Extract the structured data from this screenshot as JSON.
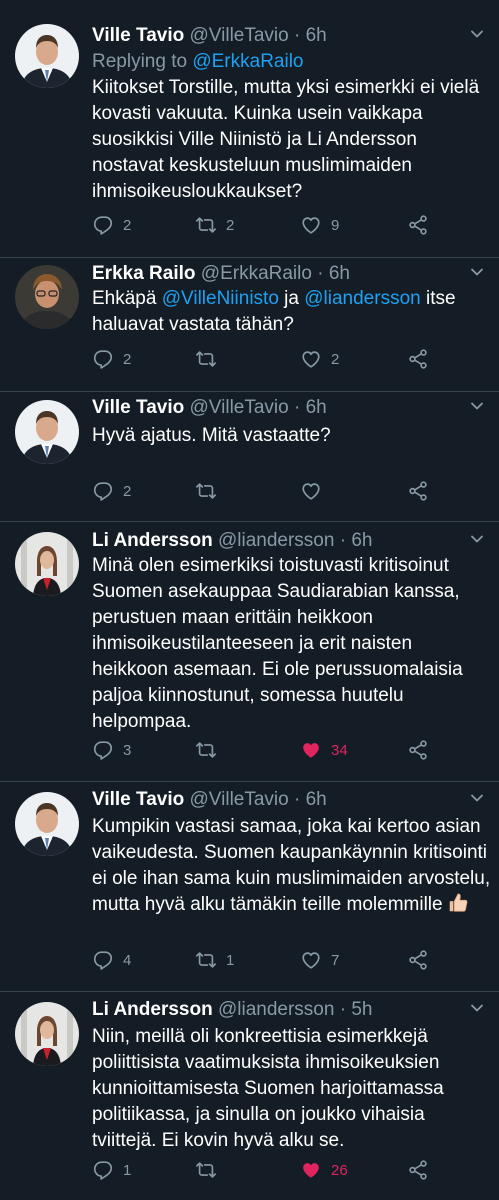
{
  "tweets": [
    {
      "name": "Ville Tavio",
      "handle": "@VilleTavio · 6h",
      "reply_prefix": "Replying to ",
      "reply_to": "@ErkkaRailo",
      "text": "Kiitokset Torstille, mutta yksi esimerkki ei vielä kovasti vakuuta. Kuinka usein vaikkapa suosikkisi Ville Niinistö ja Li Andersson nostavat keskusteluun muslimimaiden ihmisoikeusloukkaukset?",
      "replies": "2",
      "retweets": "2",
      "likes": "9"
    },
    {
      "name": "Erkka Railo",
      "handle": "@ErkkaRailo · 6h",
      "text_a": "Ehkäpä ",
      "mention_a": "@VilleNiinisto",
      "text_b": " ja ",
      "mention_b": "@liandersson",
      "text_c": " itse haluavat vastata tähän?",
      "replies": "2",
      "retweets": "",
      "likes": "2"
    },
    {
      "name": "Ville Tavio",
      "handle": "@VilleTavio · 6h",
      "text": "Hyvä ajatus. Mitä vastaatte?",
      "replies": "2",
      "retweets": "",
      "likes": ""
    },
    {
      "name": "Li Andersson",
      "handle": "@liandersson · 6h",
      "text": "Minä olen esimerkiksi toistuvasti kritisoinut Suomen asekauppaa Saudiarabian kanssa, perustuen maan erittäin heikkoon ihmisoikeustilanteeseen ja erit naisten heikkoon asemaan. Ei ole perussuomalaisia paljoa kiinnostunut, somessa huutelu helpompaa.",
      "replies": "3",
      "retweets": "",
      "likes": "34"
    },
    {
      "name": "Ville Tavio",
      "handle": "@VilleTavio · 6h",
      "text": "Kumpikin vastasi samaa, joka kai kertoo asian vaikeudesta. Suomen kaupankäynnin kritisointi ei ole ihan sama kuin muslimimaiden arvostelu, mutta hyvä alku tämäkin teille molemmille",
      "emoji": "thumbs-up-emoji",
      "replies": "4",
      "retweets": "1",
      "likes": "7"
    },
    {
      "name": "Li Andersson",
      "handle": "@liandersson · 5h",
      "text": "Niin, meillä oli konkreettisia esimerkkejä poliittisista vaatimuksista ihmisoikeuksien kunnioittamisesta Suomen harjoittamassa politiikassa, ja sinulla on joukko vihaisia tviittejä. Ei kovin hyvä alku se.",
      "replies": "1",
      "retweets": "",
      "likes": "26"
    }
  ],
  "colors": {
    "background": "#141d26",
    "text": "#ffffff",
    "muted": "#8899a6",
    "link": "#1da1f2",
    "liked": "#e0245e",
    "divider": "#38444d"
  },
  "icons": [
    "reply-icon",
    "retweet-icon",
    "like-icon",
    "share-icon",
    "chevron-down-icon"
  ]
}
